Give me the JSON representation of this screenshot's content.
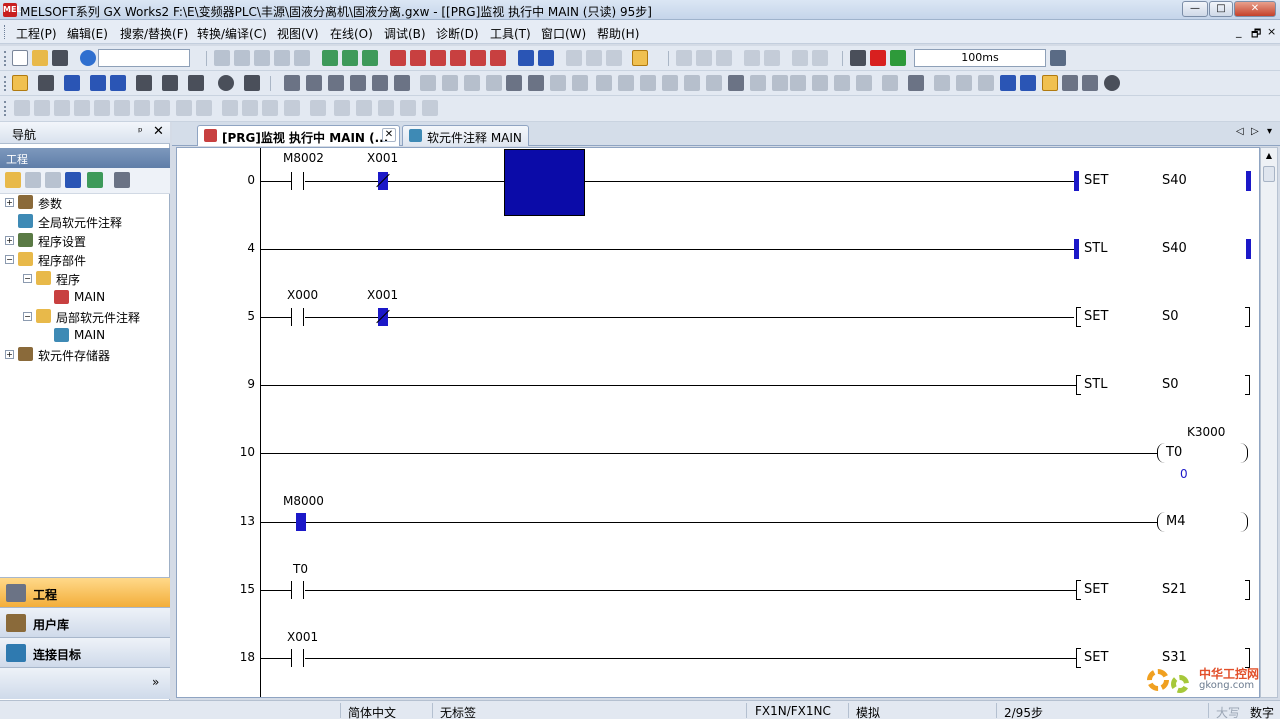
{
  "window": {
    "title": "MELSOFT系列 GX Works2 F:\\E\\变频器PLC\\丰源\\固液分离机\\固液分离.gxw - [[PRG]监视 执行中 MAIN (只读) 95步]",
    "app_icon": "MEL",
    "btn_minimize": "—",
    "btn_maximize": "□",
    "btn_close": "✕"
  },
  "menu": {
    "items": [
      "工程(P)",
      "编辑(E)",
      "搜索/替换(F)",
      "转换/编译(C)",
      "视图(V)",
      "在线(O)",
      "调试(B)",
      "诊断(D)",
      "工具(T)",
      "窗口(W)",
      "帮助(H)"
    ],
    "mdi_controls": [
      "_",
      "🗗",
      "×"
    ]
  },
  "toolbar": {
    "scan_time": "100ms",
    "combo_empty": ""
  },
  "nav": {
    "title": "导航",
    "pin": "ᵖ",
    "close": "✕",
    "section": "工程",
    "tree": [
      {
        "label": "参数",
        "exp": "+"
      },
      {
        "label": "全局软元件注释",
        "exp": ""
      },
      {
        "label": "程序设置",
        "exp": "+"
      },
      {
        "label": "程序部件",
        "exp": "−"
      },
      {
        "label": "程序",
        "exp": "−"
      },
      {
        "label": "MAIN",
        "exp": ""
      },
      {
        "label": "局部软元件注释",
        "exp": "−"
      },
      {
        "label": "MAIN",
        "exp": ""
      },
      {
        "label": "软元件存储器",
        "exp": "+"
      }
    ],
    "buttons": [
      "工程",
      "用户库",
      "连接目标"
    ],
    "expander": "»"
  },
  "tabs": [
    {
      "label": "[PRG]监视 执行中 MAIN (...",
      "close": "✕"
    },
    {
      "label": "软元件注释 MAIN"
    }
  ],
  "tab_nav": [
    "◁",
    "▷",
    "▾"
  ],
  "ladder": {
    "steps": [
      "0",
      "4",
      "5",
      "9",
      "10",
      "13",
      "15",
      "18"
    ],
    "devices": {
      "r0_c1": "M8002",
      "r0_c2": "X001",
      "r2_c1": "X000",
      "r2_c2": "X001",
      "r5_c1": "M8000",
      "r6_c1": "T0",
      "r7_c1": "X001"
    },
    "instructions": {
      "r0_op": "SET",
      "r0_dev": "S40",
      "r1_op": "STL",
      "r1_dev": "S40",
      "r2_op": "SET",
      "r2_dev": "S0",
      "r3_op": "STL",
      "r3_dev": "S0",
      "r4_dev": "T0",
      "r4_const": "K3000",
      "r4_monitor": "0",
      "r5_dev": "M4",
      "r6_op": "SET",
      "r6_dev": "S21",
      "r7_op": "SET",
      "r7_dev": "S31"
    }
  },
  "status": {
    "language": "简体中文",
    "label": "无标签",
    "cpu": "FX1N/FX1NC",
    "mode": "模拟",
    "steps": "2/95步",
    "caps": "大写",
    "num": "数字"
  },
  "watermark": {
    "line1": "中华工控网",
    "line2": "gkong.com"
  },
  "colors": {
    "monitor_blue": "#1b18c8",
    "active_nav": "#f3ae3a"
  }
}
